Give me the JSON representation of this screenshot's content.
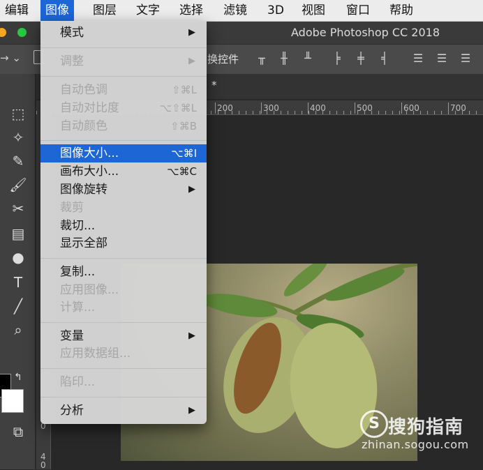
{
  "menubar": {
    "items": [
      "编辑",
      "图像",
      "图层",
      "文字",
      "选择",
      "滤镜",
      "3D",
      "视图",
      "窗口",
      "帮助"
    ],
    "active": "图像"
  },
  "window": {
    "title": "Adobe Photoshop CC 2018"
  },
  "options_bar": {
    "transform_controls_label": "换控件"
  },
  "tab": {
    "label": "*"
  },
  "ruler": {
    "labels": [
      "200",
      "300",
      "400",
      "500",
      "600",
      "700"
    ]
  },
  "vruler": {
    "labels": [
      "0",
      "4",
      "0"
    ]
  },
  "image_menu": {
    "items": [
      {
        "label": "模式",
        "shortcut": "",
        "submenu": true,
        "enabled": true,
        "highlighted": false
      },
      {
        "label": "调整",
        "shortcut": "",
        "submenu": true,
        "enabled": false,
        "highlighted": false
      },
      {
        "label": "自动色调",
        "shortcut": "⇧⌘L",
        "submenu": false,
        "enabled": false,
        "highlighted": false
      },
      {
        "label": "自动对比度",
        "shortcut": "⌥⇧⌘L",
        "submenu": false,
        "enabled": false,
        "highlighted": false
      },
      {
        "label": "自动颜色",
        "shortcut": "⇧⌘B",
        "submenu": false,
        "enabled": false,
        "highlighted": false
      },
      {
        "label": "图像大小...",
        "shortcut": "⌥⌘I",
        "submenu": false,
        "enabled": true,
        "highlighted": true
      },
      {
        "label": "画布大小...",
        "shortcut": "⌥⌘C",
        "submenu": false,
        "enabled": true,
        "highlighted": false
      },
      {
        "label": "图像旋转",
        "shortcut": "",
        "submenu": true,
        "enabled": true,
        "highlighted": false
      },
      {
        "label": "裁剪",
        "shortcut": "",
        "submenu": false,
        "enabled": false,
        "highlighted": false
      },
      {
        "label": "裁切...",
        "shortcut": "",
        "submenu": false,
        "enabled": true,
        "highlighted": false
      },
      {
        "label": "显示全部",
        "shortcut": "",
        "submenu": false,
        "enabled": true,
        "highlighted": false
      },
      {
        "label": "复制...",
        "shortcut": "",
        "submenu": false,
        "enabled": true,
        "highlighted": false
      },
      {
        "label": "应用图像...",
        "shortcut": "",
        "submenu": false,
        "enabled": false,
        "highlighted": false
      },
      {
        "label": "计算...",
        "shortcut": "",
        "submenu": false,
        "enabled": false,
        "highlighted": false
      },
      {
        "label": "变量",
        "shortcut": "",
        "submenu": true,
        "enabled": true,
        "highlighted": false
      },
      {
        "label": "应用数据组...",
        "shortcut": "",
        "submenu": false,
        "enabled": false,
        "highlighted": false
      },
      {
        "label": "陷印...",
        "shortcut": "",
        "submenu": false,
        "enabled": false,
        "highlighted": false
      },
      {
        "label": "分析",
        "shortcut": "",
        "submenu": true,
        "enabled": true,
        "highlighted": false
      }
    ],
    "submenu_arrow": "▶"
  },
  "watermark": {
    "text": "搜狗指南",
    "url": "zhinan.sogou.com"
  },
  "colors": {
    "menu_highlight": "#1d66d6",
    "traffic_red": "#fc5f57",
    "traffic_green": "#28c940"
  }
}
